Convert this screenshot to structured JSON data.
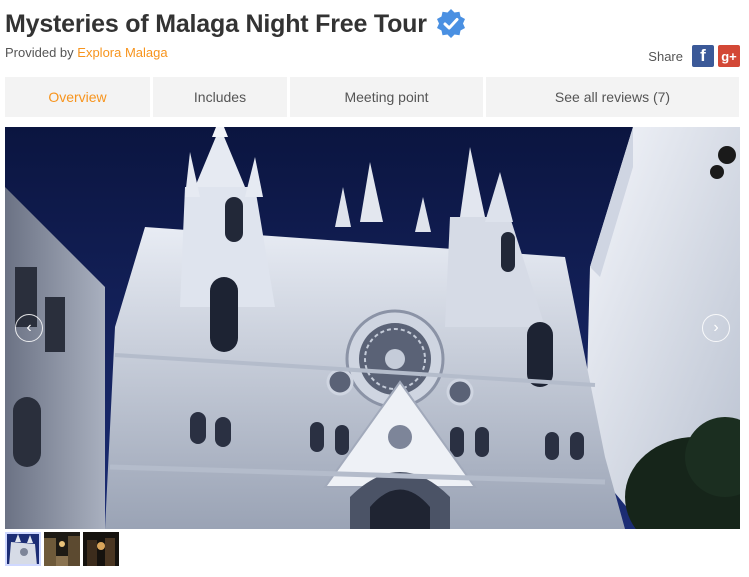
{
  "tour": {
    "title": "Mysteries of Malaga Night Free Tour",
    "provided_by_label": "Provided by",
    "provider_name": "Explora Malaga"
  },
  "share": {
    "label": "Share",
    "facebook_glyph": "f",
    "google_plus_glyph": "g+"
  },
  "tabs": [
    {
      "label": "Overview",
      "active": true
    },
    {
      "label": "Includes",
      "active": false
    },
    {
      "label": "Meeting point",
      "active": false
    },
    {
      "label": "See all reviews (7)",
      "active": false
    }
  ],
  "gallery": {
    "main_image": "night-illuminated-gothic-church-facade",
    "prev_glyph": "‹",
    "next_glyph": "›",
    "thumbnails": [
      "church-facade-thumb",
      "night-plaza-thumb",
      "dark-street-thumb"
    ]
  },
  "colors": {
    "accent": "#f7941d",
    "facebook": "#3b5998",
    "google_plus": "#d34836",
    "verified": "#4a90e2",
    "tab_bg": "#f3f3f3",
    "night_sky": "#0f1a4a"
  },
  "icons": {
    "verified": "verified-check-icon",
    "facebook": "facebook-icon",
    "google_plus": "google-plus-icon",
    "prev": "chevron-left-icon",
    "next": "chevron-right-icon"
  }
}
